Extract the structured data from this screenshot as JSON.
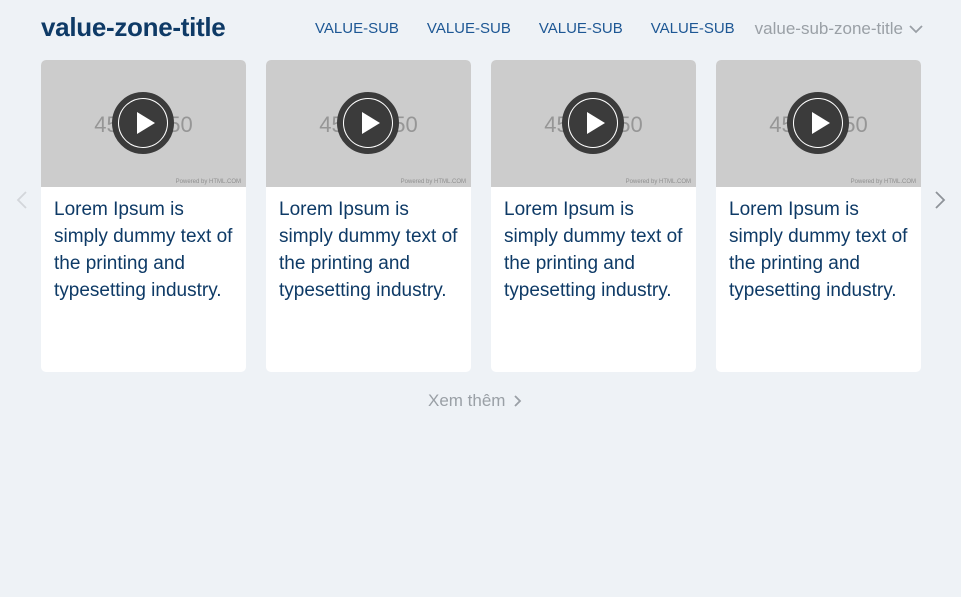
{
  "zone": {
    "title": "value-zone-title",
    "sub_links": [
      "VALUE-SUB",
      "VALUE-SUB",
      "VALUE-SUB",
      "VALUE-SUB"
    ],
    "sub_dropdown_label": "value-sub-zone-title"
  },
  "cards": [
    {
      "thumb_text": "450 × 250",
      "powered": "Powered by HTML.COM",
      "title": "Lorem Ipsum is simply dummy text of the printing and typesetting industry."
    },
    {
      "thumb_text": "450 × 250",
      "powered": "Powered by HTML.COM",
      "title": "Lorem Ipsum is simply dummy text of the printing and typesetting industry."
    },
    {
      "thumb_text": "450 × 250",
      "powered": "Powered by HTML.COM",
      "title": "Lorem Ipsum is simply dummy text of the printing and typesetting industry."
    },
    {
      "thumb_text": "450 × 250",
      "powered": "Powered by HTML.COM",
      "title": "Lorem Ipsum is simply dummy text of the printing and typesetting industry."
    }
  ],
  "see_more_label": "Xem thêm",
  "icons": {
    "play": "play-icon",
    "prev": "chevron-left-icon",
    "next": "chevron-right-icon",
    "dropdown": "chevron-down-icon"
  },
  "colors": {
    "title": "#0e3a66",
    "link": "#1d5794",
    "muted": "#9aa0a6",
    "background": "#eef2f6"
  }
}
